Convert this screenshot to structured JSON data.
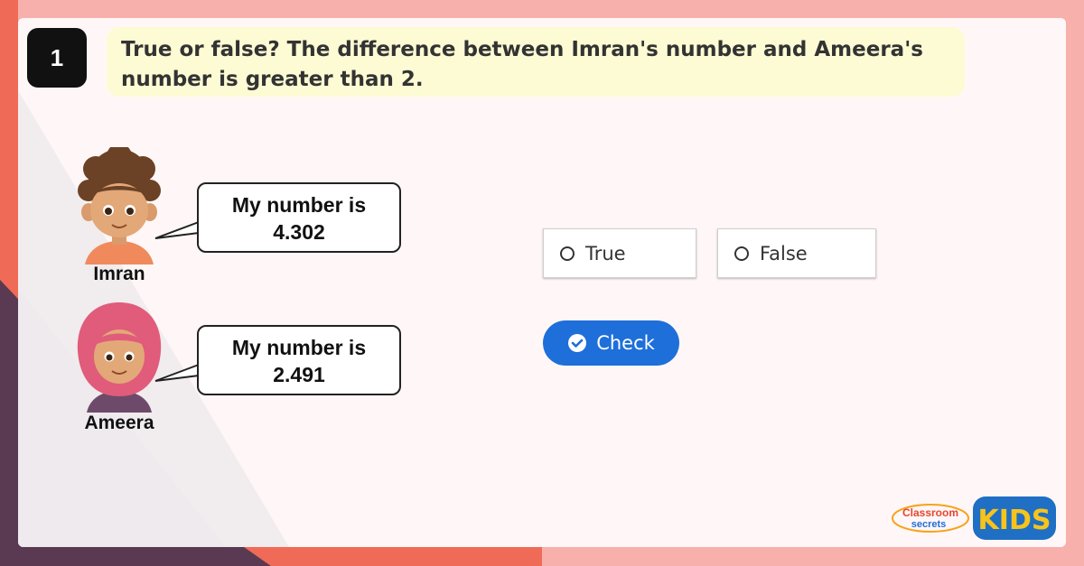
{
  "question": {
    "number": "1",
    "text": "True or false? The difference between Imran's number and Ameera's number is greater than 2."
  },
  "characters": [
    {
      "name": "Imran",
      "speech_line1": "My number is",
      "speech_line2": "4.302"
    },
    {
      "name": "Ameera",
      "speech_line1": "My number is",
      "speech_line2": "2.491"
    }
  ],
  "options": [
    {
      "label": "True"
    },
    {
      "label": "False"
    }
  ],
  "check_button": {
    "label": "Check"
  },
  "branding": {
    "classroom_line1": "Classroom",
    "classroom_line2": "secrets",
    "kids": "KIDS"
  },
  "colors": {
    "accent_blue": "#1e6fd9",
    "question_bg": "#fdfbd3",
    "frame_pink": "#f7b0ab",
    "frame_red": "#ef6b57",
    "frame_purple": "#5a3a52"
  }
}
